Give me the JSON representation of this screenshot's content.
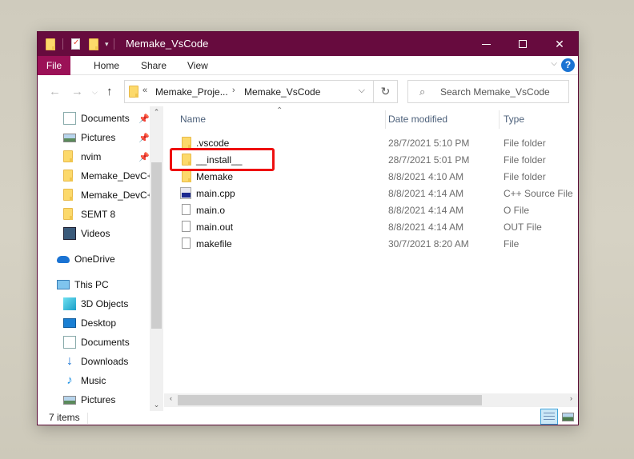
{
  "window": {
    "title": "Memake_VsCode",
    "accent_color": "#670b3e",
    "file_tab_color": "#9b1157"
  },
  "ribbon": {
    "tabs": [
      {
        "label": "File"
      },
      {
        "label": "Home"
      },
      {
        "label": "Share"
      },
      {
        "label": "View"
      }
    ]
  },
  "address_bar": {
    "overflow_symbol": "«",
    "segments": [
      "Memake_Proje...",
      "Memake_VsCode"
    ],
    "separator": "›"
  },
  "search": {
    "placeholder": "Search Memake_VsCode"
  },
  "nav_pane": {
    "quick_access": [
      {
        "label": "Documents",
        "icon": "documents-icon",
        "pinned": true
      },
      {
        "label": "Pictures",
        "icon": "pictures-icon",
        "pinned": true
      },
      {
        "label": "nvim",
        "icon": "folder-icon",
        "pinned": true
      },
      {
        "label": "Memake_DevC+",
        "icon": "folder-icon",
        "pinned": false
      },
      {
        "label": "Memake_DevC+",
        "icon": "folder-icon",
        "pinned": false
      },
      {
        "label": "SEMT 8",
        "icon": "folder-icon",
        "pinned": false
      },
      {
        "label": "Videos",
        "icon": "videos-icon",
        "pinned": false
      }
    ],
    "onedrive": {
      "label": "OneDrive",
      "icon": "cloud-icon"
    },
    "this_pc": {
      "label": "This PC",
      "icon": "monitor-icon"
    },
    "pc_items": [
      {
        "label": "3D Objects",
        "icon": "cube-icon"
      },
      {
        "label": "Desktop",
        "icon": "desktop-icon"
      },
      {
        "label": "Documents",
        "icon": "documents-icon"
      },
      {
        "label": "Downloads",
        "icon": "download-arrow-icon"
      },
      {
        "label": "Music",
        "icon": "music-note-icon"
      },
      {
        "label": "Pictures",
        "icon": "pictures-icon"
      }
    ]
  },
  "file_list": {
    "columns": [
      "Name",
      "Date modified",
      "Type"
    ],
    "sorted_by": "Name",
    "rows": [
      {
        "name": ".vscode",
        "date": "28/7/2021 5:10 PM",
        "type": "File folder",
        "icon": "folder-icon"
      },
      {
        "name": "__install__",
        "date": "28/7/2021 5:01 PM",
        "type": "File folder",
        "icon": "folder-icon",
        "highlighted": true
      },
      {
        "name": "Memake",
        "date": "8/8/2021 4:10 AM",
        "type": "File folder",
        "icon": "folder-icon"
      },
      {
        "name": "main.cpp",
        "date": "8/8/2021 4:14 AM",
        "type": "C++ Source File",
        "icon": "cpp-file-icon"
      },
      {
        "name": "main.o",
        "date": "8/8/2021 4:14 AM",
        "type": "O File",
        "icon": "file-icon"
      },
      {
        "name": "main.out",
        "date": "8/8/2021 4:14 AM",
        "type": "OUT File",
        "icon": "file-icon"
      },
      {
        "name": "makefile",
        "date": "30/7/2021 8:20 AM",
        "type": "File",
        "icon": "file-icon"
      }
    ],
    "highlight_color": "#ee0f0f"
  },
  "status_bar": {
    "item_count": "7 items",
    "active_view": "details"
  }
}
